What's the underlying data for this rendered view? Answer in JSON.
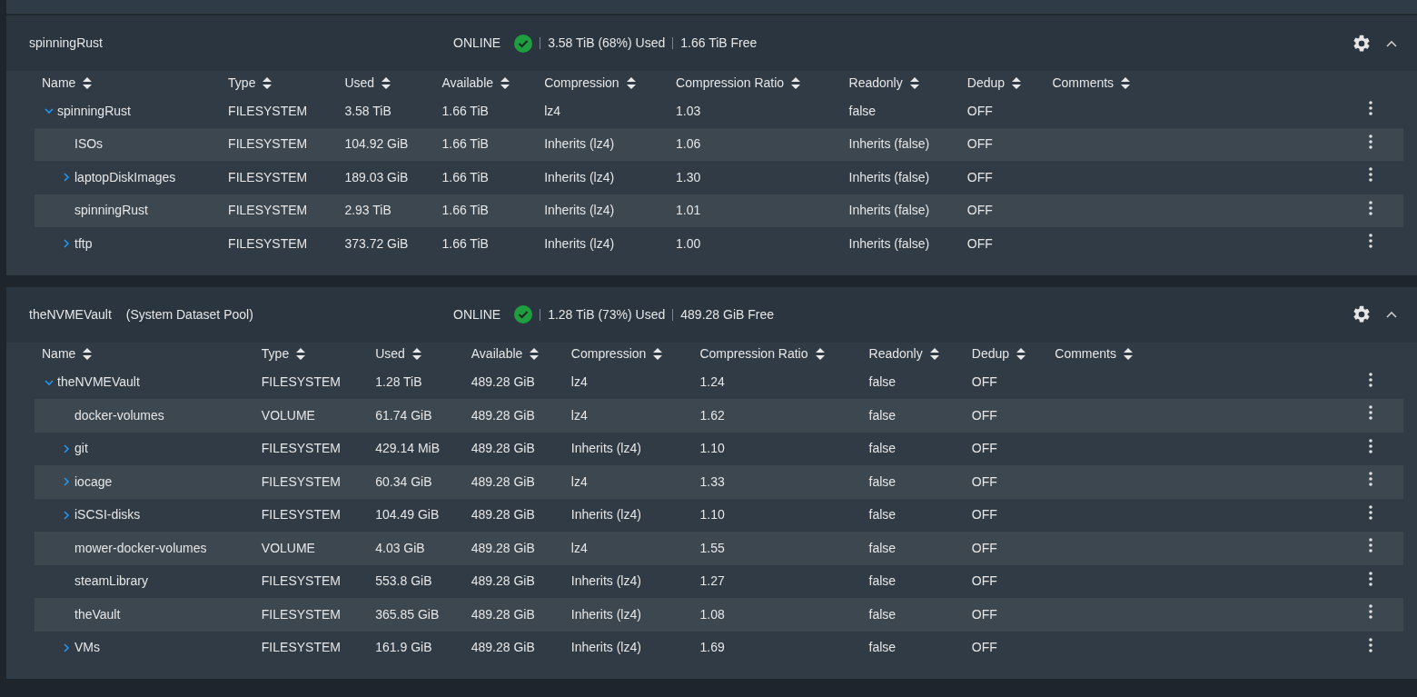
{
  "pools": [
    {
      "name": "spinningRust",
      "status": "ONLINE",
      "used": "3.58 TiB (68%) Used",
      "free": "1.66 TiB Free",
      "expanded": true,
      "columns": [
        "Name",
        "Type",
        "Used",
        "Available",
        "Compression",
        "Compression Ratio",
        "Readonly",
        "Dedup",
        "Comments"
      ],
      "root": {
        "name": "spinningRust",
        "expanded": true,
        "cells": [
          "FILESYSTEM",
          "3.58 TiB",
          "1.66 TiB",
          "lz4",
          "1.03",
          "false",
          "OFF"
        ],
        "children": [
          {
            "name": "ISOs",
            "kind": "leaf",
            "cells": [
              "FILESYSTEM",
              "104.92 GiB",
              "1.66 TiB",
              "Inherits (lz4)",
              "1.06",
              "Inherits (false)",
              "OFF"
            ]
          },
          {
            "name": "laptopDiskImages",
            "kind": "branch",
            "expanded": false,
            "cells": [
              "FILESYSTEM",
              "189.03 GiB",
              "1.66 TiB",
              "Inherits (lz4)",
              "1.30",
              "Inherits (false)",
              "OFF"
            ]
          },
          {
            "name": "spinningRust",
            "kind": "leaf",
            "cells": [
              "FILESYSTEM",
              "2.93 TiB",
              "1.66 TiB",
              "Inherits (lz4)",
              "1.01",
              "Inherits (false)",
              "OFF"
            ]
          },
          {
            "name": "tftp",
            "kind": "branch",
            "expanded": false,
            "cells": [
              "FILESYSTEM",
              "373.72 GiB",
              "1.66 TiB",
              "Inherits (lz4)",
              "1.00",
              "Inherits (false)",
              "OFF"
            ]
          }
        ]
      }
    },
    {
      "name": "theNVMEVault",
      "note": "(System Dataset Pool)",
      "status": "ONLINE",
      "used": "1.28 TiB (73%) Used",
      "free": "489.28 GiB Free",
      "expanded": true,
      "columns": [
        "Name",
        "Type",
        "Used",
        "Available",
        "Compression",
        "Compression Ratio",
        "Readonly",
        "Dedup",
        "Comments"
      ],
      "root": {
        "name": "theNVMEVault",
        "expanded": true,
        "cells": [
          "FILESYSTEM",
          "1.28 TiB",
          "489.28 GiB",
          "lz4",
          "1.24",
          "false",
          "OFF"
        ],
        "children": [
          {
            "name": "docker-volumes",
            "kind": "leaf",
            "cells": [
              "VOLUME",
              "61.74 GiB",
              "489.28 GiB",
              "lz4",
              "1.62",
              "false",
              "OFF"
            ]
          },
          {
            "name": "git",
            "kind": "branch",
            "expanded": false,
            "cells": [
              "FILESYSTEM",
              "429.14 MiB",
              "489.28 GiB",
              "Inherits (lz4)",
              "1.10",
              "false",
              "OFF"
            ]
          },
          {
            "name": "iocage",
            "kind": "branch",
            "expanded": false,
            "cells": [
              "FILESYSTEM",
              "60.34 GiB",
              "489.28 GiB",
              "lz4",
              "1.33",
              "false",
              "OFF"
            ]
          },
          {
            "name": "iSCSI-disks",
            "kind": "branch",
            "expanded": false,
            "cells": [
              "FILESYSTEM",
              "104.49 GiB",
              "489.28 GiB",
              "Inherits (lz4)",
              "1.10",
              "false",
              "OFF"
            ]
          },
          {
            "name": "mower-docker-volumes",
            "kind": "leaf",
            "cells": [
              "VOLUME",
              "4.03 GiB",
              "489.28 GiB",
              "lz4",
              "1.55",
              "false",
              "OFF"
            ]
          },
          {
            "name": "steamLibrary",
            "kind": "leaf",
            "cells": [
              "FILESYSTEM",
              "553.8 GiB",
              "489.28 GiB",
              "Inherits (lz4)",
              "1.27",
              "false",
              "OFF"
            ]
          },
          {
            "name": "theVault",
            "kind": "leaf",
            "cells": [
              "FILESYSTEM",
              "365.85 GiB",
              "489.28 GiB",
              "Inherits (lz4)",
              "1.08",
              "false",
              "OFF"
            ]
          },
          {
            "name": "VMs",
            "kind": "branch",
            "expanded": false,
            "cells": [
              "FILESYSTEM",
              "161.9 GiB",
              "489.28 GiB",
              "Inherits (lz4)",
              "1.69",
              "false",
              "OFF"
            ]
          }
        ]
      }
    }
  ]
}
